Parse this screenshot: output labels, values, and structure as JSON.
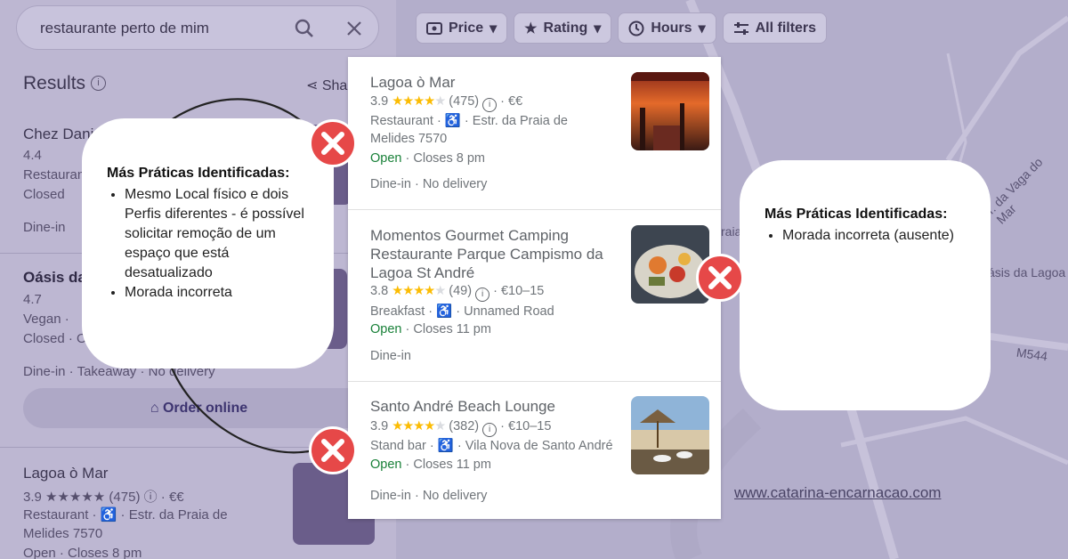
{
  "left_panel": {
    "search_value": "restaurante perto de mim",
    "results_title": "Results",
    "share_label": "Sha",
    "rows": {
      "r1_name": "Chez Daniel",
      "r1_rating": "4.4",
      "r1_type": "Restaurant",
      "r1_status": "Closed",
      "r1_services": "Dine-in",
      "r2_name": "Oásis da",
      "r2_rating": "4.7",
      "r2_type": "Vegan · ",
      "r2_status": "Closed · Op",
      "r2_services": "Dine-in · Takeaway · No delivery",
      "order_label": "Order online",
      "r3_name": "Lagoa ò Mar",
      "r3_rating_line": "3.9 ★★★★★ (475) ⓘ · €€",
      "r3_type_line": "Restaurant · ♿ · Estr. da Praia de",
      "r3_addr": "Melides 7570",
      "r3_hours": "Open · Closes 8 pm"
    }
  },
  "filters": [
    {
      "icon": "price-icon",
      "label": "Price"
    },
    {
      "icon": "star-icon",
      "label": "Rating"
    },
    {
      "icon": "clock-icon",
      "label": "Hours"
    },
    {
      "icon": "sliders-icon",
      "label": "All filters"
    }
  ],
  "map_labels": {
    "road1": "r. da Vaga do Mar",
    "place1": "ásis da Lagoa",
    "road2": "M544",
    "frag": "raia"
  },
  "listings": [
    {
      "name": "Lagoa ò Mar",
      "rating": "3.9",
      "stars": 4,
      "reviews": "(475)",
      "price": "€€",
      "category": "Restaurant",
      "address": "Estr. da Praia de",
      "address2": "Melides 7570",
      "open": "Open",
      "hours": "Closes 8 pm",
      "services": "Dine-in · No delivery"
    },
    {
      "name": "Momentos Gourmet Camping Restaurante Parque Campismo da Lagoa St André",
      "rating": "3.8",
      "stars": 4,
      "reviews": "(49)",
      "price": "€10–15",
      "category": "Breakfast",
      "address": "Unnamed Road",
      "open": "Open",
      "hours": "Closes 11 pm",
      "services": "Dine-in"
    },
    {
      "name": "Santo André Beach Lounge",
      "rating": "3.9",
      "stars": 4,
      "reviews": "(382)",
      "price": "€10–15",
      "category": "Stand bar",
      "address": "Vila Nova de Santo André",
      "open": "Open",
      "hours": "Closes 11 pm",
      "services": "Dine-in · No delivery"
    }
  ],
  "annotations": {
    "left_title": "Más Práticas Identificadas:",
    "left_items": [
      "Mesmo Local físico e dois Perfis diferentes - é possível solicitar remoção de um espaço que está desatualizado",
      "Morada incorreta"
    ],
    "right_title": "Más Práticas Identificadas:",
    "right_items": [
      "Morada incorreta (ausente)"
    ]
  },
  "website": "www.catarina-encarnacao.com",
  "colors": {
    "open": "#188038",
    "star": "#fbbc04",
    "badge": "#e64848",
    "overlay": "#b9b3cd"
  }
}
